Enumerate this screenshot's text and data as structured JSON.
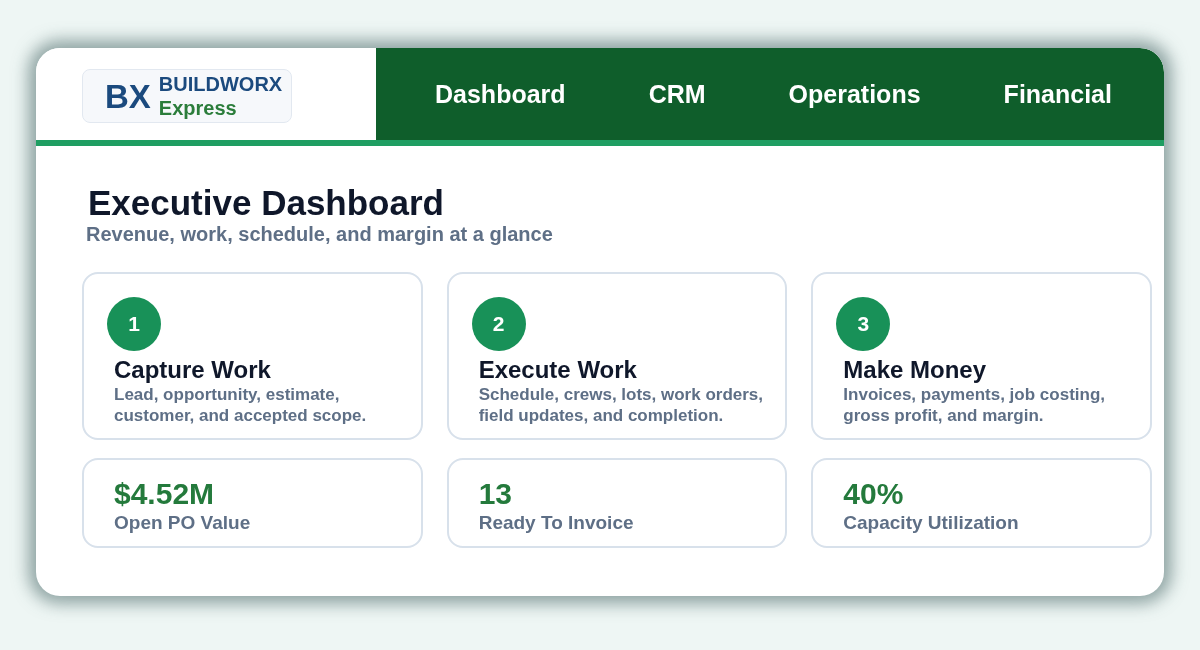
{
  "logo": {
    "monogram": "BX",
    "name": "BUILDWORX",
    "tagline": "Express"
  },
  "nav": [
    {
      "label": "Dashboard"
    },
    {
      "label": "CRM"
    },
    {
      "label": "Operations"
    },
    {
      "label": "Financial"
    }
  ],
  "page": {
    "title": "Executive Dashboard",
    "subtitle": "Revenue, work, schedule, and margin at a glance"
  },
  "steps": [
    {
      "number": "1",
      "title": "Capture Work",
      "description": "Lead, opportunity, estimate, customer, and accepted scope."
    },
    {
      "number": "2",
      "title": "Execute Work",
      "description": "Schedule, crews, lots, work orders, field updates, and completion."
    },
    {
      "number": "3",
      "title": "Make Money",
      "description": "Invoices, payments, job costing, gross profit, and margin."
    }
  ],
  "metrics": [
    {
      "value": "$4.52M",
      "label": "Open PO Value"
    },
    {
      "value": "13",
      "label": "Ready To Invoice"
    },
    {
      "value": "40%",
      "label": "Capacity Utilization"
    }
  ]
}
